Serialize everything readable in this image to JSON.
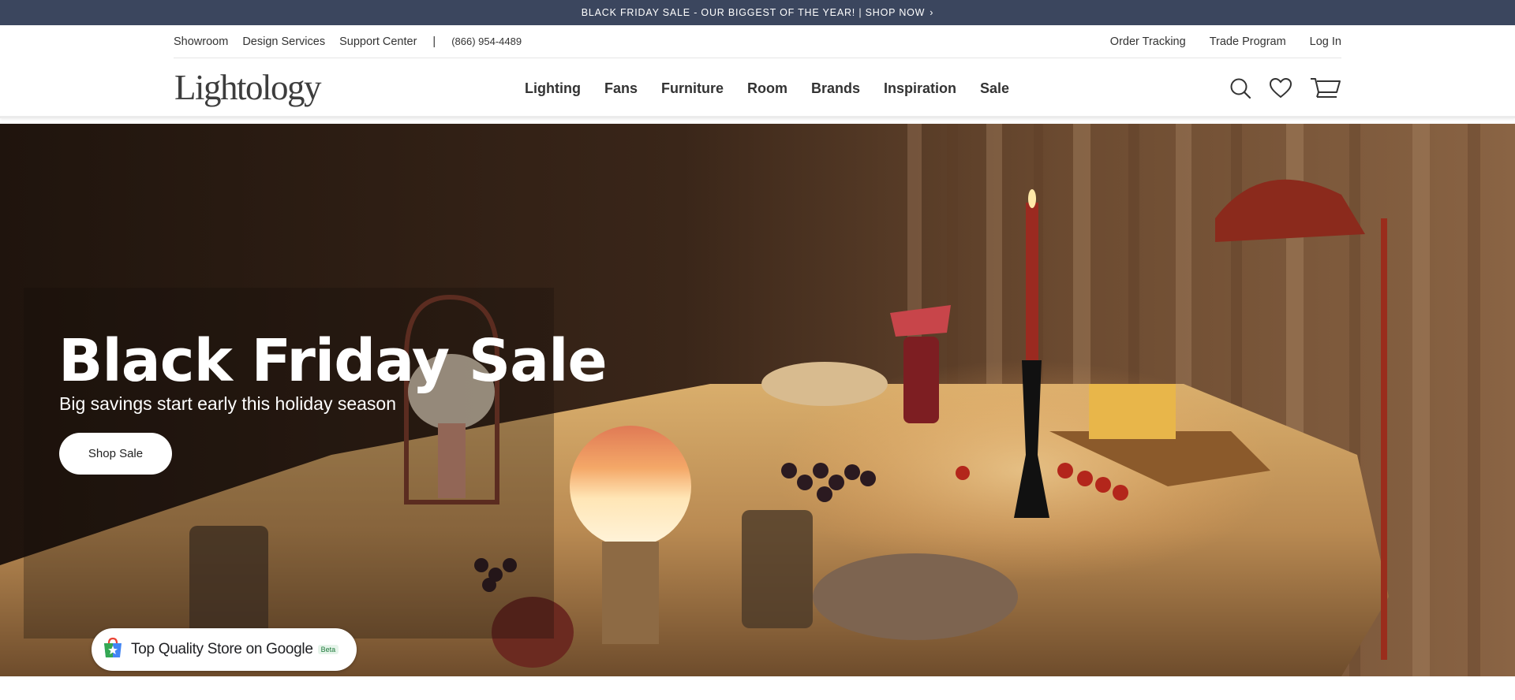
{
  "promo": {
    "text": "BLACK FRIDAY SALE - OUR BIGGEST OF THE YEAR! | SHOP NOW",
    "arrow": "›"
  },
  "utility": {
    "left_links": [
      "Showroom",
      "Design Services",
      "Support Center"
    ],
    "separator": "|",
    "phone": "(866) 954-4489",
    "right_links": [
      "Order Tracking",
      "Trade Program",
      "Log In"
    ]
  },
  "header": {
    "logo": "Lightology",
    "nav": [
      "Lighting",
      "Fans",
      "Furniture",
      "Room",
      "Brands",
      "Inspiration",
      "Sale"
    ],
    "icons": [
      "search-icon",
      "heart-icon",
      "cart-icon"
    ]
  },
  "hero": {
    "title": "Black Friday Sale",
    "subtitle": "Big savings start early this holiday season",
    "button_label": "Shop Sale"
  },
  "google_badge": {
    "text": "Top Quality Store on Google",
    "beta": "Beta"
  },
  "colors": {
    "promo_bg": "#3b465e",
    "text_dark": "#333333",
    "hero_text": "#ffffff"
  }
}
